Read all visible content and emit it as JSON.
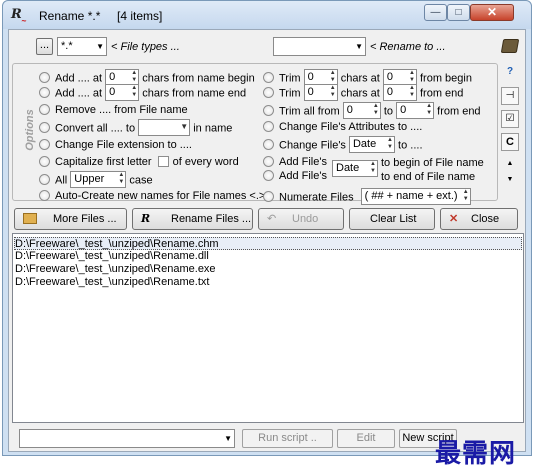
{
  "window": {
    "title": "Rename  *.*",
    "item_count": "[4 items]",
    "min_glyph": "—",
    "max_glyph": "□",
    "close_glyph": "✕"
  },
  "filter": {
    "dot_button": "...",
    "file_types_value": "*.*",
    "file_types_hint": "< File types ...",
    "rename_to_value": "",
    "rename_to_hint": "< Rename to ..."
  },
  "options": {
    "group_label": "Options",
    "left": [
      {
        "pre": "Add .... at",
        "spin": "0",
        "post": "chars from name begin"
      },
      {
        "pre": "Add .... at",
        "spin": "0",
        "post": "chars from name end"
      },
      {
        "text": "Remove .... from File name"
      },
      {
        "pre": "Convert all .... to",
        "field": "",
        "post": "in name"
      },
      {
        "text": "Change File extension to ...."
      },
      {
        "text": "Capitalize first letter",
        "check_label": "of every word"
      },
      {
        "pre": "All",
        "field": "Upper",
        "post": "case"
      },
      {
        "text": "Auto-Create new names for File names <.>"
      }
    ],
    "right": [
      {
        "pre": "Trim",
        "spin1": "0",
        "mid": "chars at",
        "spin2": "0",
        "post": "from begin"
      },
      {
        "pre": "Trim",
        "spin1": "0",
        "mid": "chars at",
        "spin2": "0",
        "post": "from end"
      },
      {
        "pre": "Trim all from",
        "spin1": "0",
        "mid": "to",
        "spin2": "0",
        "post": "from end"
      },
      {
        "text": "Change File's Attributes to ...."
      },
      {
        "pre": "Change File's",
        "field": "Date",
        "post": "to ...."
      },
      {
        "pre": "Add File's",
        "field": "Date",
        "post1": "to begin of File name",
        "post2": "to end of File name"
      },
      {
        "pre": "Add File's"
      },
      {
        "pre": "Numerate Files",
        "field": "( ## + name + ext.)"
      }
    ]
  },
  "buttons": {
    "more_files": "More Files ...",
    "rename_files": "Rename Files ...",
    "undo": "Undo",
    "clear_list": "Clear List",
    "close": "Close"
  },
  "files": [
    "D:\\Freeware\\_test_\\unziped\\Rename.chm",
    "D:\\Freeware\\_test_\\unziped\\Rename.dll",
    "D:\\Freeware\\_test_\\unziped\\Rename.exe",
    "D:\\Freeware\\_test_\\unziped\\Rename.txt"
  ],
  "bottom": {
    "script_value": "",
    "run_script": "Run script ..",
    "edit": "Edit",
    "new_script": "New script"
  },
  "watermark": "最需网",
  "icons": [
    "app-rename-icon",
    "book-icon",
    "help-icon",
    "pin-icon",
    "checklist-icon",
    "c-icon",
    "scroll-up-icon",
    "scroll-down-icon",
    "folder-add-icon",
    "rename-icon",
    "undo-icon",
    "close-x-icon"
  ]
}
